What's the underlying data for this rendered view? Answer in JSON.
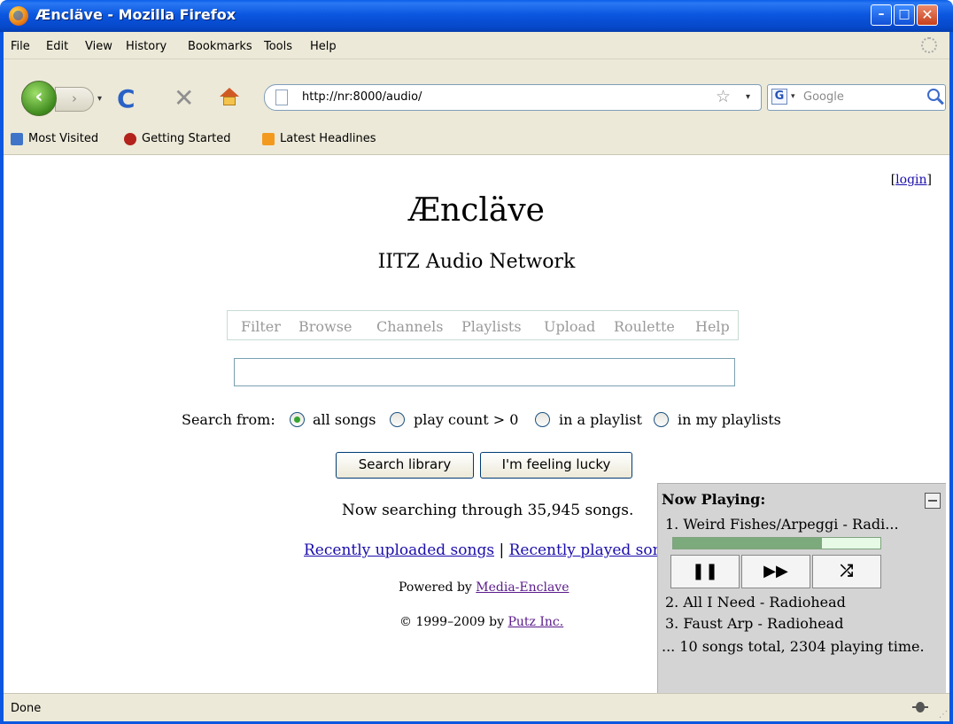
{
  "window": {
    "title": "Æncläve - Mozilla Firefox",
    "min_glyph": "–",
    "max_glyph": "□",
    "close_glyph": "✕"
  },
  "menu": [
    "File",
    "Edit",
    "View",
    "History",
    "Bookmarks",
    "Tools",
    "Help"
  ],
  "nav": {
    "back_glyph": "‹",
    "forward_glyph": "›",
    "reload_glyph": "C",
    "stop_glyph": "✕",
    "url": "http://nr:8000/audio/",
    "star_glyph": "☆",
    "search_engine_glyph": "G",
    "search_placeholder": "Google"
  },
  "bookmarks": [
    "Most Visited",
    "Getting Started",
    "Latest Headlines"
  ],
  "page": {
    "login_open": "[",
    "login_label": "login",
    "login_close": "]",
    "title": "Æncläve",
    "subtitle": "IITZ Audio Network",
    "tabs": [
      "Filter",
      "Browse",
      "Channels",
      "Playlists",
      "Upload",
      "Roulette",
      "Help"
    ],
    "search_value": "",
    "search_from_label": "Search from:",
    "radio_options": [
      {
        "label": "all songs",
        "checked": true
      },
      {
        "label": "play count > 0",
        "checked": false
      },
      {
        "label": "in a playlist",
        "checked": false
      },
      {
        "label": "in my playlists",
        "checked": false
      }
    ],
    "buttons": {
      "search": "Search library",
      "lucky": "I'm feeling lucky"
    },
    "count_text": "Now searching through 35,945 songs.",
    "recent_uploaded": "Recently uploaded songs",
    "separator": " | ",
    "recent_played": "Recently played songs",
    "powered_by": "Powered by ",
    "powered_link": "Media-Enclave",
    "copyright": "© 1999–2009 by ",
    "copyright_link": "Putz Inc."
  },
  "now_playing": {
    "heading": "Now Playing:",
    "current": "1.  Weird Fishes/Arpeggi - Radi...",
    "progress": 0.72,
    "controls": {
      "pause": "❚❚",
      "next": "▶▶",
      "shuffle": "⤮"
    },
    "queue": [
      "2.  All I Need - Radiohead",
      "3.  Faust Arp - Radiohead"
    ],
    "summary": "... 10 songs total, 2304 playing time."
  },
  "status": {
    "text": "Done"
  },
  "colors": {
    "title_bar": "#0b57e0",
    "chrome": "#ece9d8",
    "link": "#1a0dab",
    "visited_link": "#5a1a8a",
    "progress_fill": "#7daa7d"
  }
}
